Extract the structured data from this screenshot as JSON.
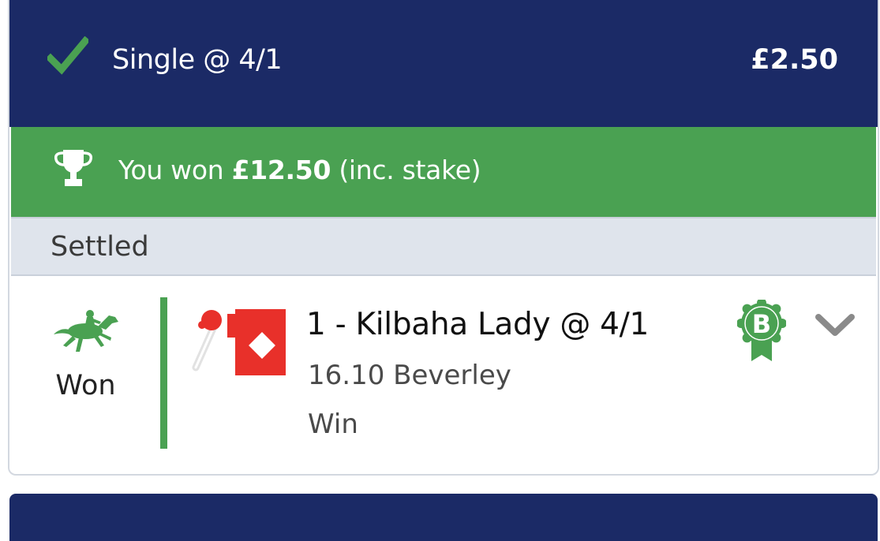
{
  "bet": {
    "type_label": "Single @ 4/1",
    "stake": "£2.50",
    "status_icon": "check-icon"
  },
  "win_banner": {
    "prefix": "You won",
    "amount": "£12.50",
    "suffix": "(inc. stake)",
    "icon": "trophy-icon"
  },
  "status": {
    "label": "Settled"
  },
  "selection": {
    "result": "Won",
    "result_icon": "horse-racing-icon",
    "name": "1 - Kilbaha Lady @ 4/1",
    "event": "16.10 Beverley",
    "market": "Win",
    "boost_badge": "B",
    "silks_icon": "jockey-silks-icon",
    "expand_icon": "chevron-down-icon"
  },
  "colors": {
    "header_bg": "#1b2a66",
    "win_green": "#4aa152",
    "status_bg": "#dfe4ec",
    "silks_red": "#e8302a"
  }
}
